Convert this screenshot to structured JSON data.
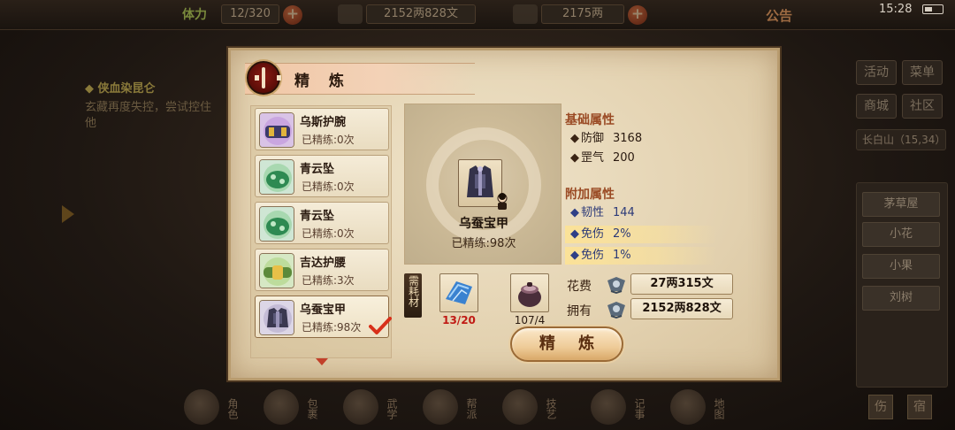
{
  "topbar": {
    "stamina_label": "体力",
    "stamina_value": "12/320",
    "copper_value": "2152两828文",
    "silver_value": "2175两",
    "notice_label": "公告",
    "clock": "15:28"
  },
  "left_quest": {
    "title": "◆ 侠血染昆仑",
    "desc": "玄藏再度失控，尝试控住他"
  },
  "right_panel": {
    "buttons": [
      "活动",
      "菜单",
      "商城",
      "社区"
    ],
    "location": "长白山（15,34）",
    "npcs": [
      "茅草屋",
      "小花",
      "小果",
      "刘树"
    ]
  },
  "bottom_bar": {
    "items": [
      "角色",
      "包裹",
      "武学",
      "帮派",
      "技艺",
      "记事",
      "地图"
    ],
    "right_buttons": [
      "伤",
      "宿"
    ]
  },
  "dialog": {
    "title": "精 炼",
    "items": [
      {
        "name": "乌斯护腕",
        "level": "已精练:0次",
        "thumb": "bracer-purple"
      },
      {
        "name": "青云坠",
        "level": "已精练:0次",
        "thumb": "pendant-green"
      },
      {
        "name": "青云坠",
        "level": "已精练:0次",
        "thumb": "pendant-green"
      },
      {
        "name": "吉达护腰",
        "level": "已精练:3次",
        "thumb": "belt-gold"
      },
      {
        "name": "乌蚕宝甲",
        "level": "已精练:98次",
        "thumb": "armor-dark"
      }
    ],
    "selected_index": 4,
    "preview": {
      "name": "乌蚕宝甲",
      "level": "已精练:98次"
    },
    "base_attr_title": "基础属性",
    "base_attrs": [
      {
        "name": "防御",
        "value": "3168"
      },
      {
        "name": "罡气",
        "value": "200"
      }
    ],
    "extra_attr_title": "附加属性",
    "extra_attrs": [
      {
        "name": "韧性",
        "value": "144",
        "highlight": false
      },
      {
        "name": "免伤",
        "value": "2%",
        "highlight": true
      },
      {
        "name": "免伤",
        "value": "1%",
        "highlight": true
      }
    ],
    "materials_label": "需耗材",
    "materials": [
      {
        "count": "13/20",
        "icon": "blue-silk",
        "insufficient": true
      },
      {
        "count": "107/4",
        "icon": "pot",
        "insufficient": false
      }
    ],
    "cost_label": "花费",
    "cost_value": "27两315文",
    "own_label": "拥有",
    "own_value": "2152两828文",
    "refine_button": "精 炼"
  },
  "colors": {
    "accent_red": "#c01a14",
    "attr_header": "#9a4a24",
    "extra_attr_blue": "#2c3a78",
    "highlight_gold": "#fce296"
  }
}
